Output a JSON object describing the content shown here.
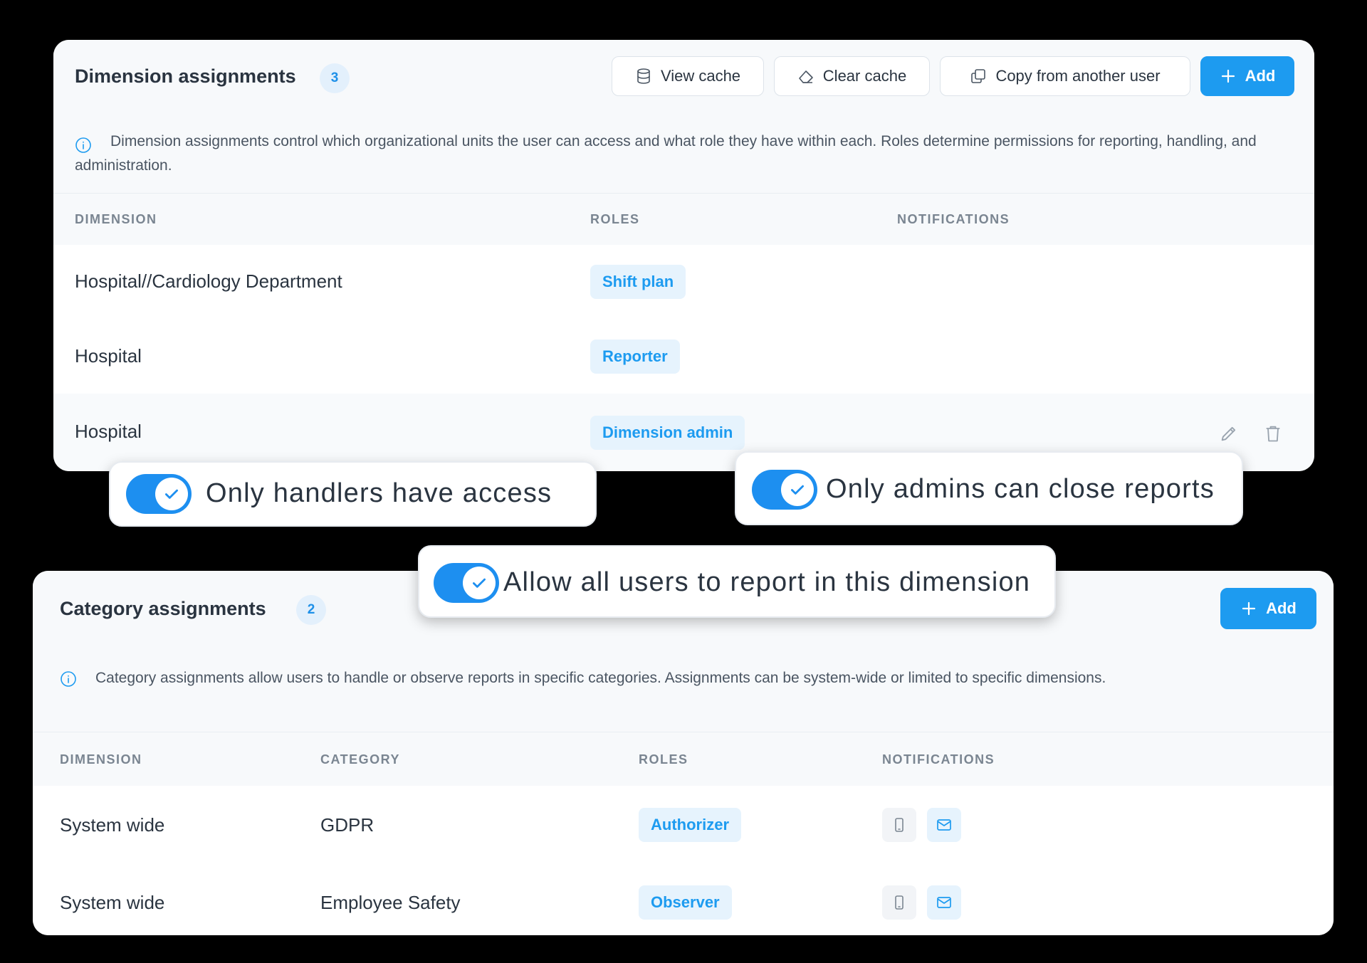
{
  "dimension_card": {
    "title": "Dimension assignments",
    "count": "3",
    "buttons": {
      "view_cache": "View cache",
      "clear_cache": "Clear cache",
      "copy": "Copy from another user",
      "add": "Add"
    },
    "info": "Dimension assignments control which organizational units the user can access and what role they have within each. Roles determine permissions for reporting, handling, and administration.",
    "columns": [
      "DIMENSION",
      "ROLES",
      "NOTIFICATIONS"
    ],
    "rows": [
      {
        "dimension": "Hospital//Cardiology Department",
        "role": "Shift plan"
      },
      {
        "dimension": "Hospital",
        "role": "Reporter"
      },
      {
        "dimension": "Hospital",
        "role": "Dimension admin"
      }
    ]
  },
  "toggles": {
    "handlers": {
      "label": "Only handlers have access",
      "on": true
    },
    "admins": {
      "label": "Only admins can close reports",
      "on": true
    },
    "all_users": {
      "label": "Allow all users to report in this dimension",
      "on": true
    }
  },
  "category_card": {
    "title": "Category assignments",
    "count": "2",
    "buttons": {
      "add": "Add"
    },
    "info": "Category assignments allow users to handle or observe reports in specific categories. Assignments can be system-wide or limited to specific dimensions.",
    "columns": [
      "DIMENSION",
      "CATEGORY",
      "ROLES",
      "NOTIFICATIONS"
    ],
    "rows": [
      {
        "dimension": "System wide",
        "category": "GDPR",
        "role": "Authorizer",
        "notif_mobile": false,
        "notif_email": true
      },
      {
        "dimension": "System wide",
        "category": "Employee Safety",
        "role": "Observer",
        "notif_mobile": false,
        "notif_email": true
      }
    ]
  },
  "colors": {
    "accent": "#1d9bf0",
    "pill_bg": "#e6f3fd",
    "toggle_on": "#1d8ff0"
  }
}
